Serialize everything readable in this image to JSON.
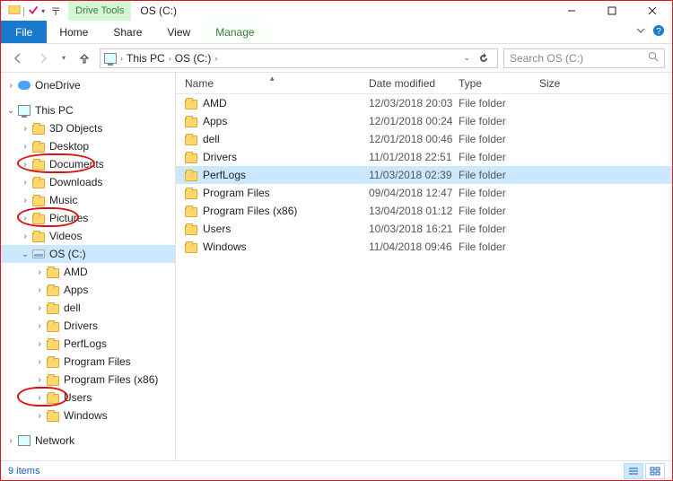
{
  "window": {
    "title": "OS (C:)",
    "drive_tools_label": "Drive Tools",
    "ribbon": {
      "file": "File",
      "home": "Home",
      "share": "Share",
      "view": "View",
      "manage": "Manage"
    }
  },
  "address": {
    "root": "This PC",
    "location": "OS (C:)",
    "search_placeholder": "Search OS (C:)"
  },
  "tree": {
    "onedrive": "OneDrive",
    "this_pc": "This PC",
    "items": [
      "3D Objects",
      "Desktop",
      "Documents",
      "Downloads",
      "Music",
      "Pictures",
      "Videos",
      "OS (C:)"
    ],
    "osc_children": [
      "AMD",
      "Apps",
      "dell",
      "Drivers",
      "PerfLogs",
      "Program Files",
      "Program Files (x86)",
      "Users",
      "Windows"
    ],
    "network": "Network"
  },
  "columns": {
    "name": "Name",
    "date": "Date modified",
    "type": "Type",
    "size": "Size"
  },
  "rows": [
    {
      "name": "AMD",
      "date": "12/03/2018 20:03",
      "type": "File folder"
    },
    {
      "name": "Apps",
      "date": "12/01/2018 00:24",
      "type": "File folder"
    },
    {
      "name": "dell",
      "date": "12/01/2018 00:46",
      "type": "File folder"
    },
    {
      "name": "Drivers",
      "date": "11/01/2018 22:51",
      "type": "File folder"
    },
    {
      "name": "PerfLogs",
      "date": "11/03/2018 02:39",
      "type": "File folder",
      "selected": true
    },
    {
      "name": "Program Files",
      "date": "09/04/2018 12:47",
      "type": "File folder"
    },
    {
      "name": "Program Files (x86)",
      "date": "13/04/2018 01:12",
      "type": "File folder"
    },
    {
      "name": "Users",
      "date": "10/03/2018 16:21",
      "type": "File folder"
    },
    {
      "name": "Windows",
      "date": "11/04/2018 09:46",
      "type": "File folder"
    }
  ],
  "status": {
    "count": "9 items"
  },
  "annotations": {
    "circled_tree_items": [
      "Documents",
      "Pictures",
      "Users"
    ]
  }
}
